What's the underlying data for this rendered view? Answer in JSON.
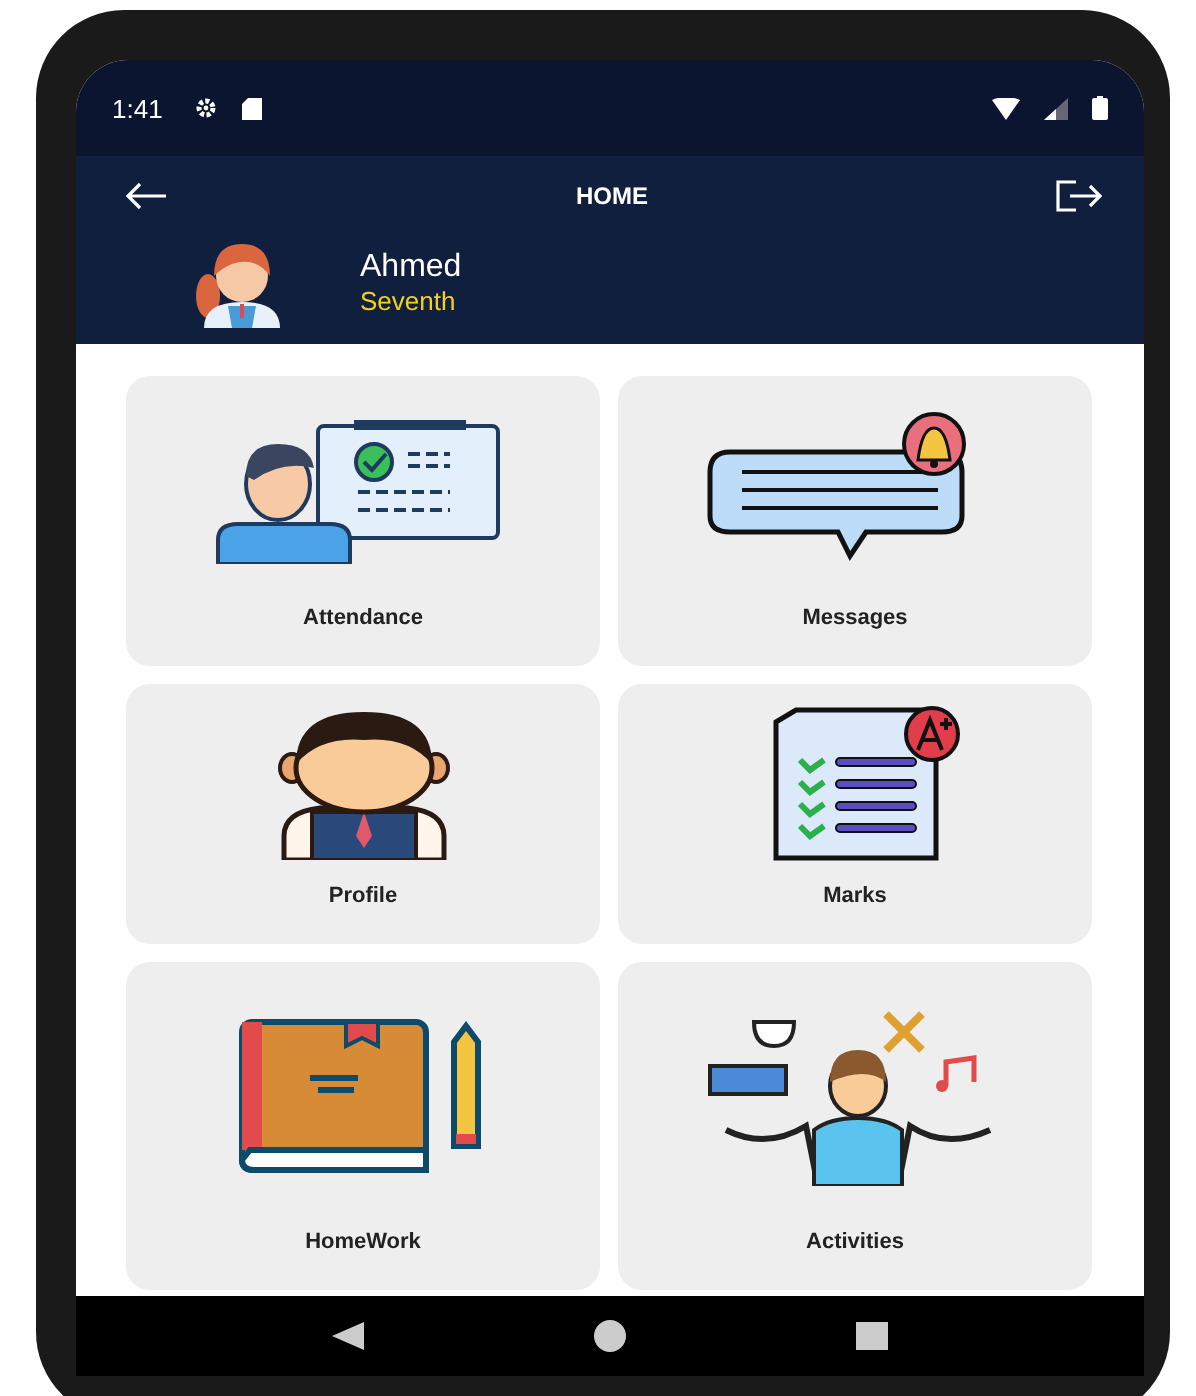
{
  "status_bar": {
    "time": "1:41"
  },
  "header": {
    "title": "HOME"
  },
  "user": {
    "name": "Ahmed",
    "grade": "Seventh"
  },
  "cards": [
    {
      "label": "Attendance",
      "kind": "attendance"
    },
    {
      "label": "Messages",
      "kind": "messages"
    },
    {
      "label": "Profile",
      "kind": "profile"
    },
    {
      "label": "Marks",
      "kind": "marks"
    },
    {
      "label": "HomeWork",
      "kind": "homework"
    },
    {
      "label": "Activities",
      "kind": "activities"
    }
  ]
}
